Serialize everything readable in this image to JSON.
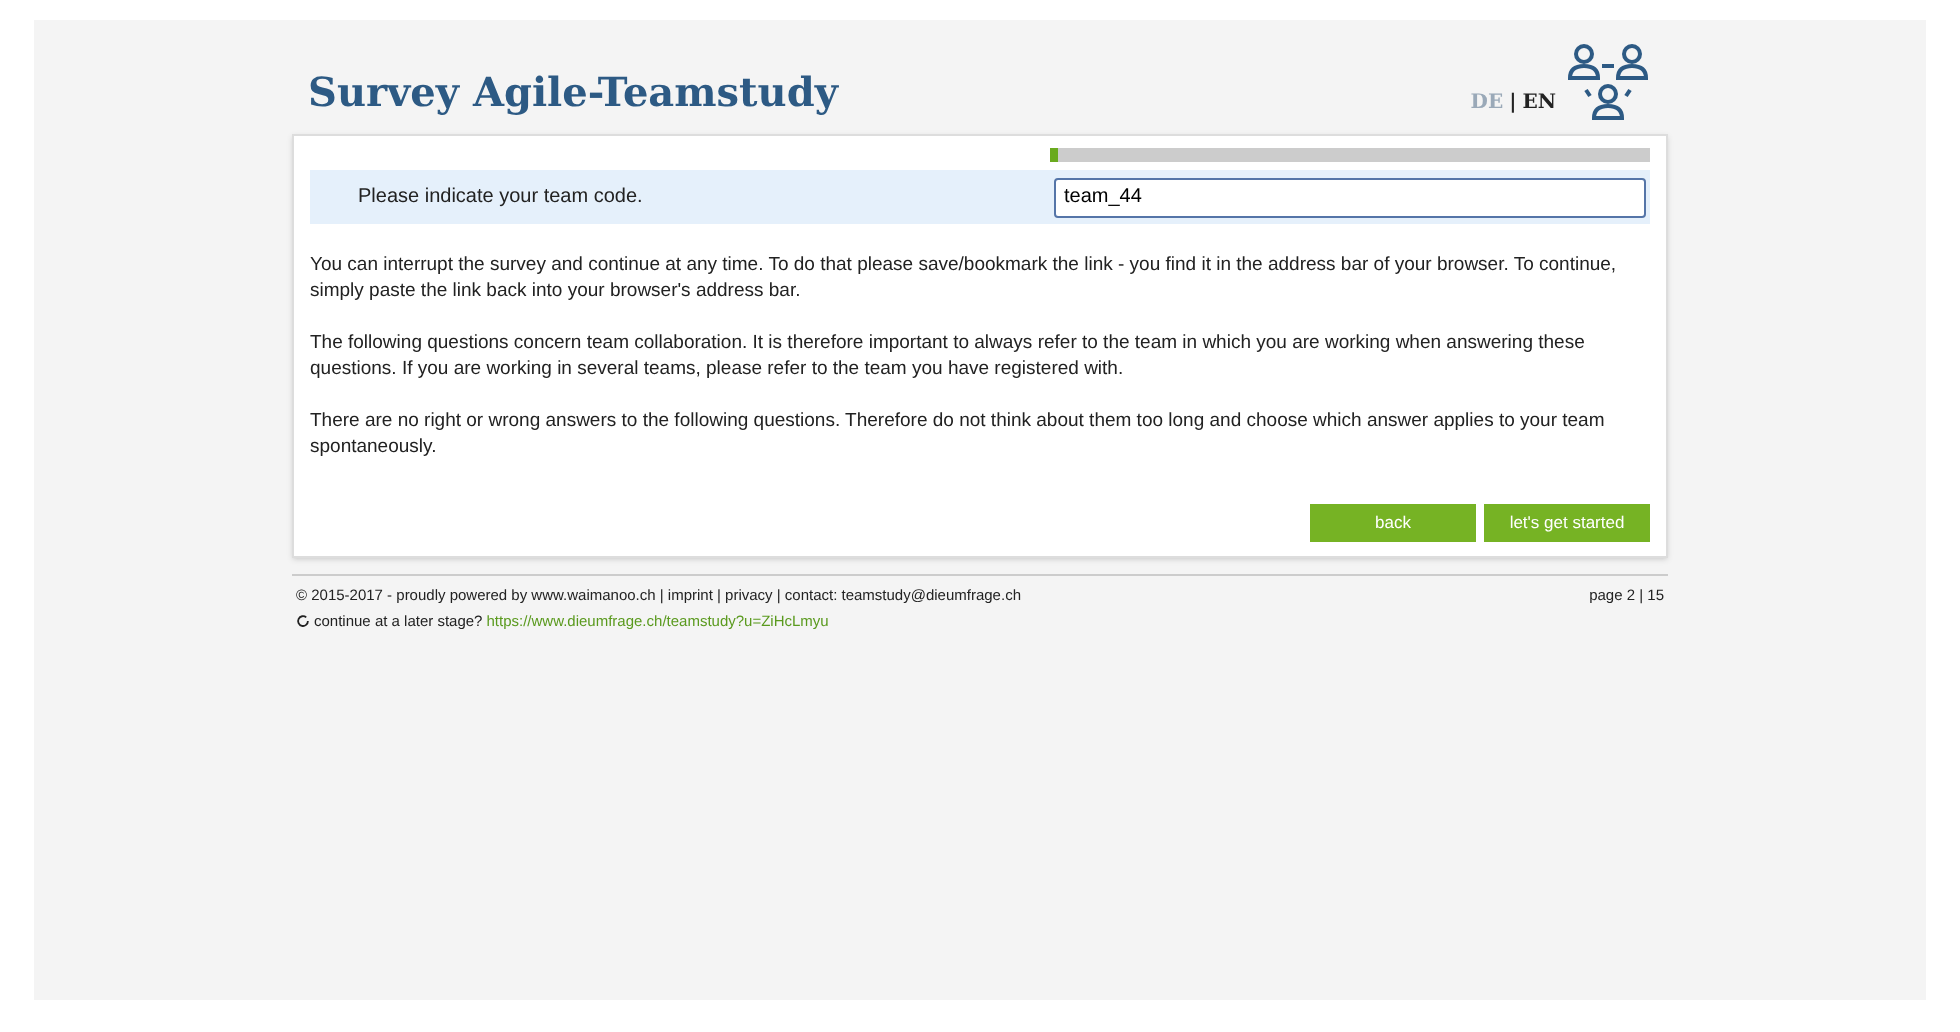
{
  "header": {
    "title": "Survey Agile-Teamstudy",
    "languages": [
      {
        "label": "DE",
        "selected": false
      },
      {
        "label": "EN",
        "selected": true
      }
    ],
    "separator": "|"
  },
  "progress": {
    "level": 0.012
  },
  "question": {
    "label": "Please indicate your team code.",
    "value": "team_44"
  },
  "paragraphs": [
    "You can interrupt the survey and continue at any time. To do that please save/bookmark the link - you find it in the address bar of your browser. To continue, simply paste the link back into your browser's address bar.",
    "The following questions concern team collaboration. It is therefore important to always refer to the team in which you are working when answering these questions. If you are working in several teams, please refer to the team you have registered with.",
    "There are no right or wrong answers to the following questions. Therefore do not think about them too long and choose which answer applies to your team spontaneously."
  ],
  "buttons": [
    "back",
    "let's get started"
  ],
  "footer": {
    "credits": "© 2015-2017 - proudly powered by www.waimanoo.ch | imprint | privacy | contact: teamstudy@dieumfrage.ch",
    "page": "page 2 | 15",
    "continue_label": "continue at a later stage?",
    "continue_link": "https://www.dieumfrage.ch/teamstudy?u=ZiHcLmyu"
  }
}
